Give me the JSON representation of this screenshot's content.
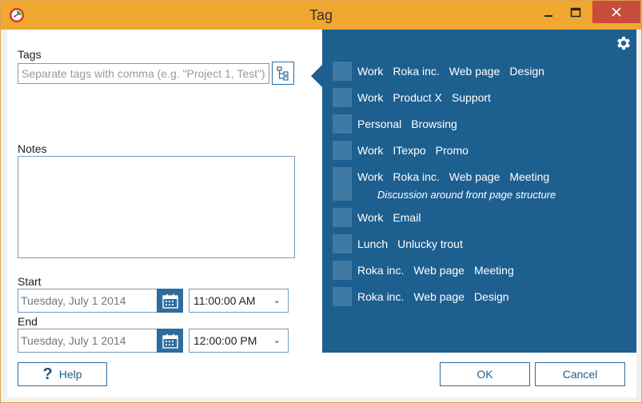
{
  "window": {
    "title": "Tag"
  },
  "tags": {
    "label": "Tags",
    "placeholder": "Separate tags with comma (e.g. \"Project 1, Test\")"
  },
  "notes": {
    "label": "Notes"
  },
  "start": {
    "label": "Start",
    "date": "Tuesday, July 1 2014",
    "time": "11:00:00 AM"
  },
  "end": {
    "label": "End",
    "date": "Tuesday, July 1 2014",
    "time": "12:00:00 PM"
  },
  "recent": [
    {
      "tags": [
        "Work",
        "Roka inc.",
        "Web page",
        "Design"
      ]
    },
    {
      "tags": [
        "Work",
        "Product X",
        "Support"
      ]
    },
    {
      "tags": [
        "Personal",
        "Browsing"
      ]
    },
    {
      "tags": [
        "Work",
        "ITexpo",
        "Promo"
      ]
    },
    {
      "tags": [
        "Work",
        "Roka inc.",
        "Web page",
        "Meeting"
      ],
      "note": "Discussion around front page structure"
    },
    {
      "tags": [
        "Work",
        "Email"
      ]
    },
    {
      "tags": [
        "Lunch",
        "Unlucky trout"
      ]
    },
    {
      "tags": [
        "Roka inc.",
        "Web page",
        "Meeting"
      ]
    },
    {
      "tags": [
        "Roka inc.",
        "Web page",
        "Design"
      ]
    }
  ],
  "footer": {
    "help": "Help",
    "ok": "OK",
    "cancel": "Cancel"
  },
  "colors": {
    "titlebar": "#f0a830",
    "panel": "#1d5f8f",
    "accent": "#2e6c9e",
    "close": "#c74c3c"
  },
  "icons": {
    "app": "clock-app-icon",
    "settings": "gear-icon",
    "calendar": "calendar-icon",
    "tree": "tree-view-icon",
    "help": "question-icon"
  }
}
